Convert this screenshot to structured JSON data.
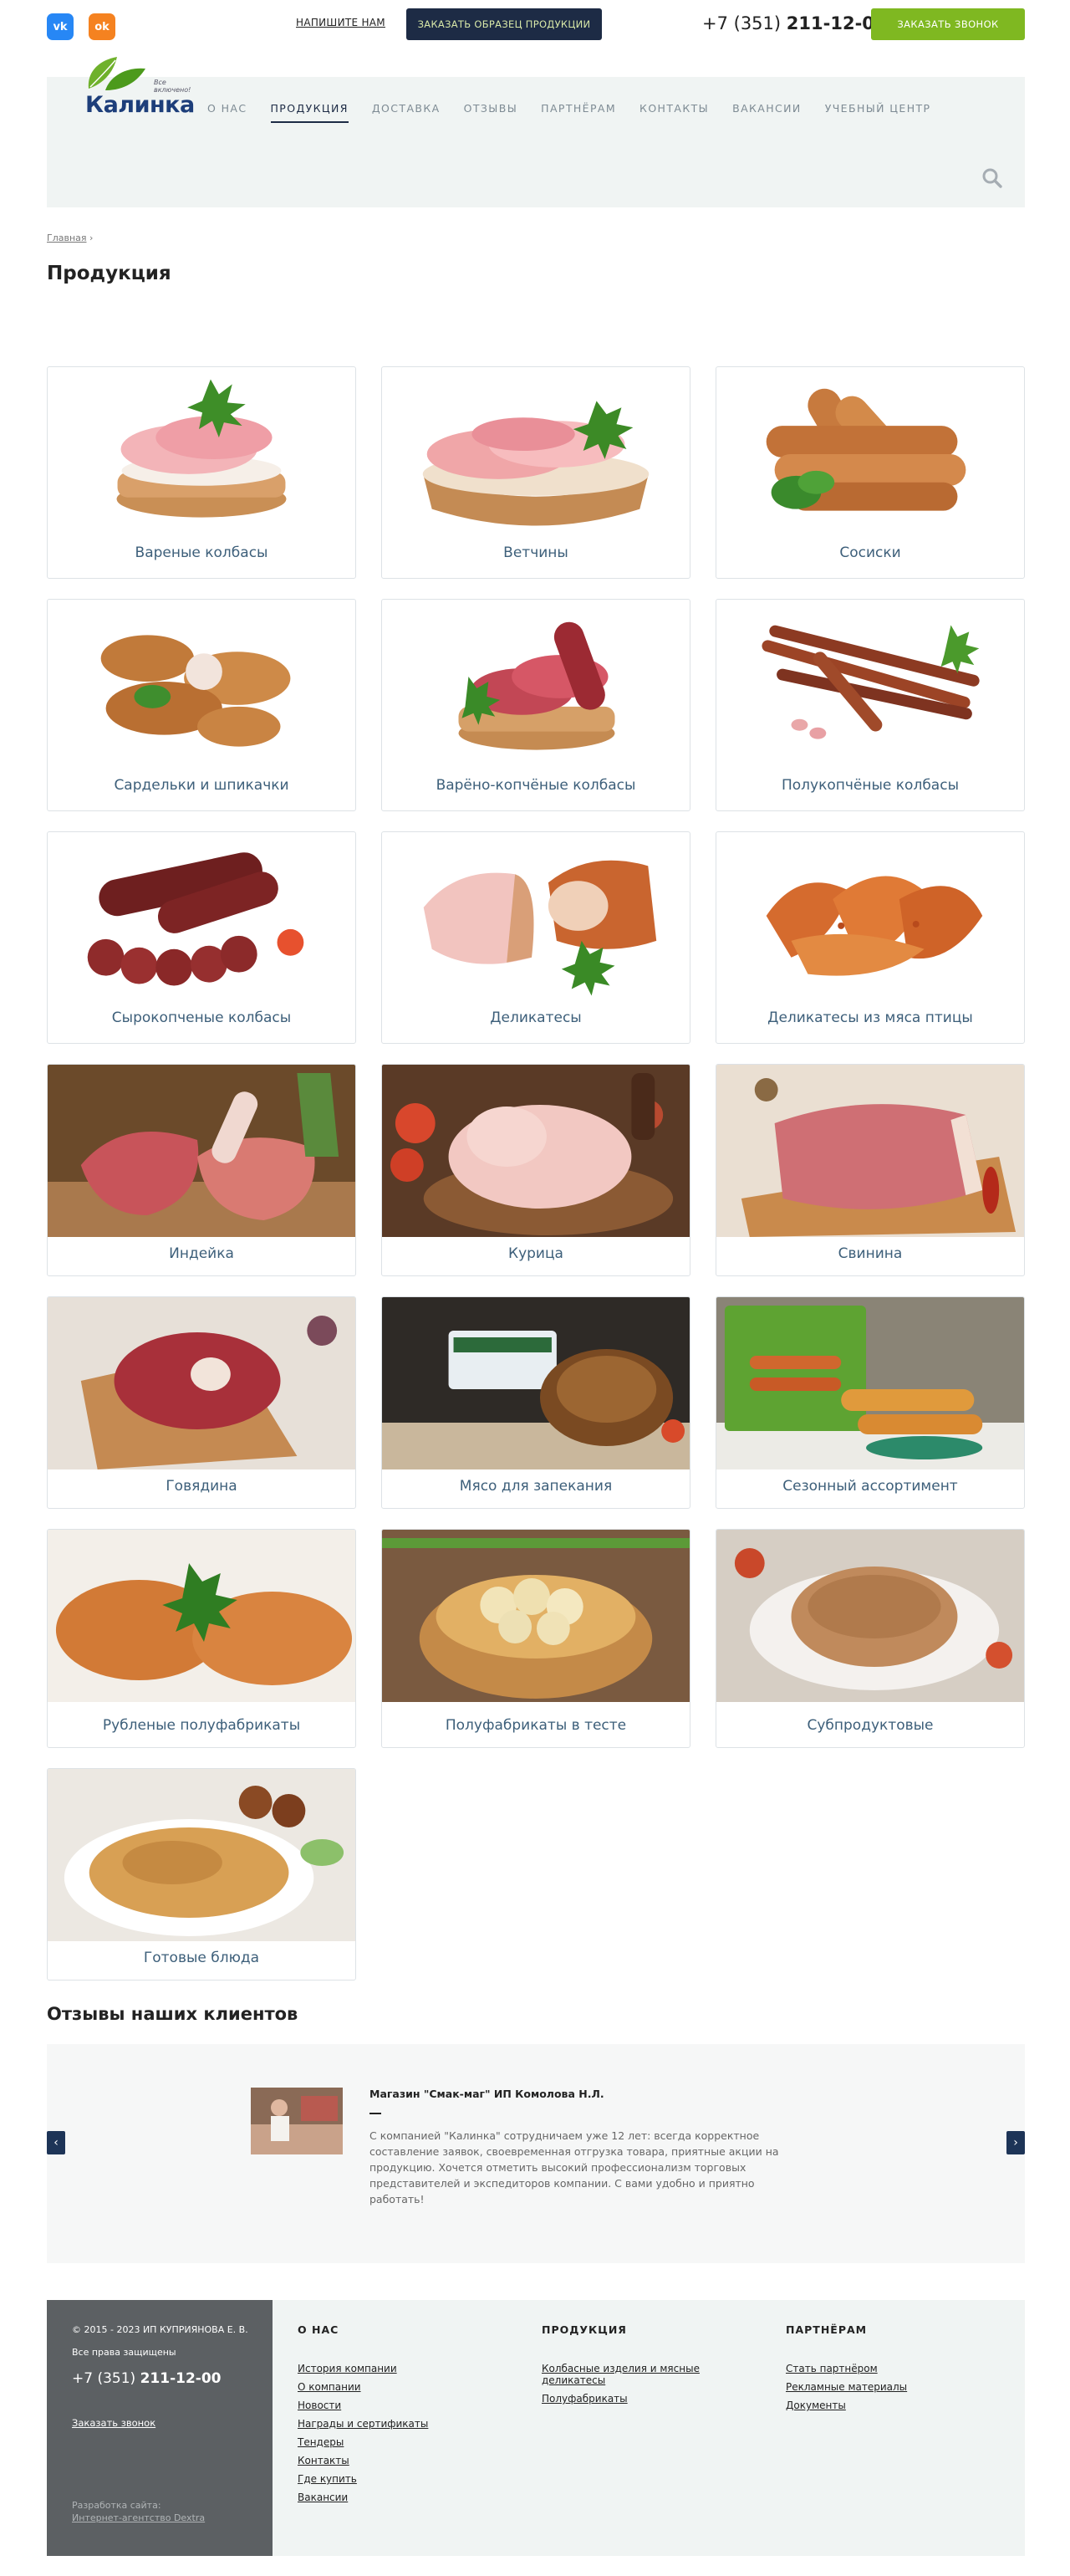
{
  "topbar": {
    "vk_label": "vk",
    "ok_label": "ok",
    "write_link": "НАПИШИТЕ НАМ",
    "sample_button": "ЗАКАЗАТЬ ОБРАЗЕЦ ПРОДУКЦИИ",
    "phone_prefix": "+7 (351)",
    "phone_number": "211-12-00",
    "call_button": "ЗАКАЗАТЬ ЗВОНОК"
  },
  "logo": {
    "name": "Калинка",
    "tagline_1": "Все",
    "tagline_2": "включено!"
  },
  "nav": {
    "items": [
      {
        "label": "О НАС",
        "active": false
      },
      {
        "label": "ПРОДУКЦИЯ",
        "active": true
      },
      {
        "label": "ДОСТАВКА",
        "active": false
      },
      {
        "label": "ОТЗЫВЫ",
        "active": false
      },
      {
        "label": "ПАРТНЁРАМ",
        "active": false
      },
      {
        "label": "КОНТАКТЫ",
        "active": false
      },
      {
        "label": "ВАКАНСИИ",
        "active": false
      },
      {
        "label": "УЧЕБНЫЙ ЦЕНТР",
        "active": false
      }
    ]
  },
  "breadcrumb": {
    "home": "Главная",
    "sep": "›"
  },
  "page_title": "Продукция",
  "products": [
    {
      "label": "Вареные колбасы",
      "icon": "boiled-sausage-image"
    },
    {
      "label": "Ветчины",
      "icon": "ham-image"
    },
    {
      "label": "Сосиски",
      "icon": "frankfurters-image"
    },
    {
      "label": "Сардельки и шпикачки",
      "icon": "wieners-image"
    },
    {
      "label": "Варёно-копчёные колбасы",
      "icon": "smoked-boiled-sausage-image"
    },
    {
      "label": "Полукопчёные колбасы",
      "icon": "semi-smoked-sausage-image"
    },
    {
      "label": "Сырокопченые колбасы",
      "icon": "dry-cured-sausage-image"
    },
    {
      "label": "Деликатесы",
      "icon": "delicacies-image"
    },
    {
      "label": "Деликатесы из мяса птицы",
      "icon": "poultry-delicacies-image"
    },
    {
      "label": "Индейка",
      "icon": "turkey-image"
    },
    {
      "label": "Курица",
      "icon": "chicken-image"
    },
    {
      "label": "Свинина",
      "icon": "pork-image"
    },
    {
      "label": "Говядина",
      "icon": "beef-image"
    },
    {
      "label": "Мясо для запекания",
      "icon": "roast-meat-image"
    },
    {
      "label": "Сезонный ассортимент",
      "icon": "seasonal-image"
    },
    {
      "label": "Рубленые полуфабрикаты",
      "icon": "cutlets-image"
    },
    {
      "label": "Полуфабрикаты в тесте",
      "icon": "dumplings-image"
    },
    {
      "label": "Субпродуктовые",
      "icon": "offal-image"
    },
    {
      "label": "Готовые блюда",
      "icon": "ready-meals-image"
    }
  ],
  "reviews": {
    "title": "Отзывы наших клиентов",
    "prev": "‹",
    "next": "›",
    "author": "Магазин \"Смак-маг\" ИП Комолова Н.Л.",
    "text": "С компанией \"Калинка\" сотрудничаем уже 12 лет: всегда корректное составление заявок, своевременная отгрузка товара, приятные акции на продукцию. Хочется отметить высокий профессионализм торговых представителей и экспедиторов компании. С вами удобно и приятно работать!"
  },
  "footer": {
    "copyright": "© 2015 - 2023 ИП КУПРИЯНОВА Е. В.",
    "rights": "Все права защищены",
    "phone_prefix": "+7 (351)",
    "phone_number": "211-12-00",
    "callback": "Заказать звонок",
    "dev_label": "Разработка сайта:",
    "dev_link": "Интернет-агентство Dextra",
    "columns": [
      {
        "title": "О НАС",
        "links": [
          "История компании",
          "О компании",
          "Новости",
          "Награды и сертификаты",
          "Тендеры",
          "Контакты",
          "Где купить",
          "Вакансии"
        ]
      },
      {
        "title": "ПРОДУКЦИЯ",
        "links": [
          "Колбасные изделия и мясные деликатесы",
          "Полуфабрикаты"
        ]
      },
      {
        "title": "ПАРТНЁРАМ",
        "links": [
          "Стать партнёром",
          "Рекламные материалы",
          "Документы"
        ]
      }
    ]
  }
}
